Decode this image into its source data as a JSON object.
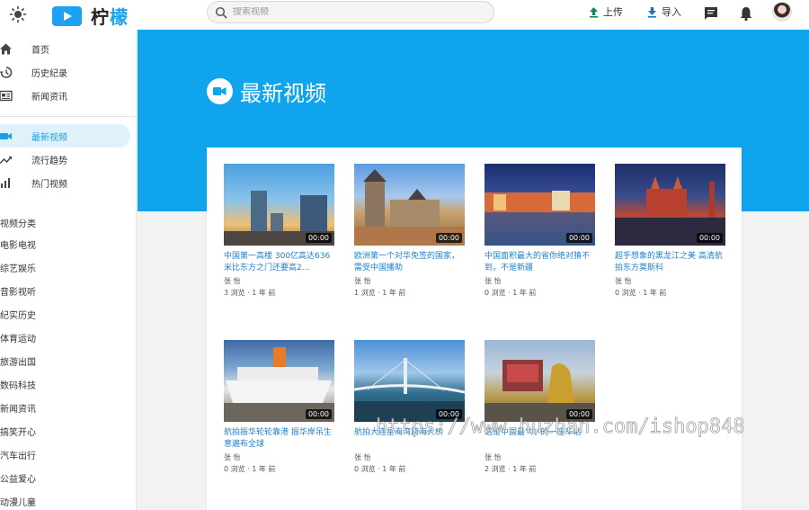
{
  "header": {
    "app_name_left": "柠",
    "app_name_right": "檬",
    "search_placeholder": "搜索视频",
    "upload_label": "上传",
    "import_label": "导入"
  },
  "sidebar": {
    "main_items": [
      {
        "label": "首页"
      },
      {
        "label": "历史纪录"
      },
      {
        "label": "新闻资讯"
      }
    ],
    "video_items": [
      {
        "label": "最新视频"
      },
      {
        "label": "流行趋势"
      },
      {
        "label": "热门视频"
      }
    ],
    "category_title": "视频分类",
    "categories": [
      "电影电视",
      "综艺娱乐",
      "音影视听",
      "纪实历史",
      "体育运动",
      "旅游出国",
      "数码科技",
      "新闻资讯",
      "搞笑开心",
      "汽车出行",
      "公益爱心",
      "动漫儿童"
    ]
  },
  "section": {
    "title": "最新视频"
  },
  "videos": [
    {
      "title": "中国第一高楼 300亿高达636米比东方之门还要高2...",
      "author": "张 怡",
      "meta": "3 浏览 · 1 年 前",
      "duration": "00:00"
    },
    {
      "title": "欧洲第一个对华免签的国家，需受中国播助",
      "author": "张 怡",
      "meta": "1 浏览 · 1 年 前",
      "duration": "00:00"
    },
    {
      "title": "中国面积最大的省你绝对猜不到，不是新疆",
      "author": "张 怡",
      "meta": "0 浏览 · 1 年 前",
      "duration": "00:00"
    },
    {
      "title": "超乎想象的黑龙江之美 高清航拍东方莫斯科",
      "author": "张 怡",
      "meta": "0 浏览 · 1 年 前",
      "duration": "00:00"
    },
    {
      "title": "航拍振华轮轮靠港 振华岸吊生意遍布全球",
      "author": "张 怡",
      "meta": "0 浏览 · 1 年 前",
      "duration": "00:00"
    },
    {
      "title": "航拍大连星海湾跨海大桥",
      "author": "张 怡",
      "meta": "0 浏览 · 1 年 前",
      "duration": "00:00"
    },
    {
      "title": "这是中国最\"坑\"的一座车站",
      "author": "张 怡",
      "meta": "2 浏览 · 1 年 前",
      "duration": "00:00"
    }
  ],
  "watermark": "https://www.huzhan.com/ishop848"
}
